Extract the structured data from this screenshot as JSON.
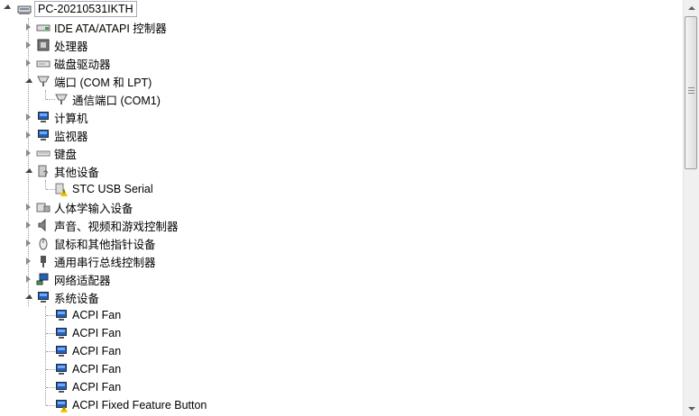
{
  "tree": {
    "root": {
      "label": "PC-20210531IKTH",
      "icon": "computer-icon"
    },
    "nodes": [
      {
        "label": "IDE ATA/ATAPI 控制器",
        "icon": "ide-controller-icon",
        "state": "collapsed"
      },
      {
        "label": "处理器",
        "icon": "processor-icon",
        "state": "collapsed"
      },
      {
        "label": "磁盘驱动器",
        "icon": "disk-drive-icon",
        "state": "collapsed"
      },
      {
        "label": "端口 (COM 和 LPT)",
        "icon": "port-icon",
        "state": "expanded",
        "children": [
          {
            "label": "通信端口 (COM1)",
            "icon": "port-icon"
          }
        ]
      },
      {
        "label": "计算机",
        "icon": "computer-icon",
        "state": "collapsed"
      },
      {
        "label": "监视器",
        "icon": "monitor-icon",
        "state": "collapsed"
      },
      {
        "label": "键盘",
        "icon": "keyboard-icon",
        "state": "collapsed"
      },
      {
        "label": "其他设备",
        "icon": "other-devices-icon",
        "state": "expanded",
        "children": [
          {
            "label": "STC USB Serial",
            "icon": "warning-device-icon"
          }
        ]
      },
      {
        "label": "人体学输入设备",
        "icon": "hid-icon",
        "state": "collapsed"
      },
      {
        "label": "声音、视频和游戏控制器",
        "icon": "speaker-icon",
        "state": "collapsed"
      },
      {
        "label": "鼠标和其他指针设备",
        "icon": "mouse-icon",
        "state": "collapsed"
      },
      {
        "label": "通用串行总线控制器",
        "icon": "usb-icon",
        "state": "collapsed"
      },
      {
        "label": "网络适配器",
        "icon": "network-icon",
        "state": "collapsed"
      },
      {
        "label": "系统设备",
        "icon": "system-devices-icon",
        "state": "expanded",
        "children": [
          {
            "label": "ACPI Fan",
            "icon": "system-device-icon"
          },
          {
            "label": "ACPI Fan",
            "icon": "system-device-icon"
          },
          {
            "label": "ACPI Fan",
            "icon": "system-device-icon"
          },
          {
            "label": "ACPI Fan",
            "icon": "system-device-icon"
          },
          {
            "label": "ACPI Fan",
            "icon": "system-device-icon"
          },
          {
            "label": "ACPI Fixed Feature Button",
            "icon": "warning-system-device-icon"
          }
        ]
      }
    ]
  },
  "colors": {
    "accent": "#1f5fbf",
    "warning": "#f2c200",
    "connector": "#9a9a9a"
  }
}
